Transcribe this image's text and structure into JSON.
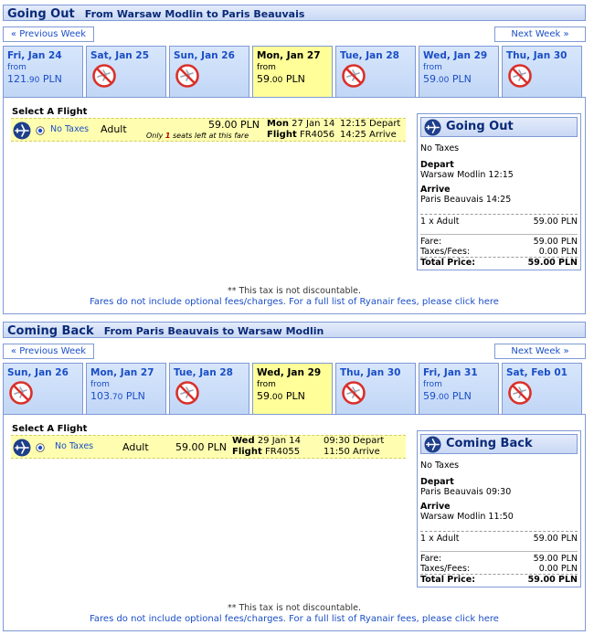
{
  "outbound": {
    "title": "Going Out",
    "route": "From Warsaw Modlin to Paris Beauvais",
    "prev_week": "« Previous Week",
    "next_week": "Next Week »",
    "days": [
      {
        "name": "Fri, Jan 24",
        "from": "from",
        "price_main": "121",
        "price_dec": ".90",
        "currency": "PLN",
        "available": true
      },
      {
        "name": "Sat, Jan 25",
        "available": false
      },
      {
        "name": "Sun, Jan 26",
        "available": false
      },
      {
        "name": "Mon, Jan 27",
        "from": "from",
        "price_main": "59",
        "price_dec": ".00",
        "currency": "PLN",
        "available": true,
        "selected": true
      },
      {
        "name": "Tue, Jan 28",
        "available": false
      },
      {
        "name": "Wed, Jan 29",
        "from": "from",
        "price_main": "59",
        "price_dec": ".00",
        "currency": "PLN",
        "available": true
      },
      {
        "name": "Thu, Jan 30",
        "available": false
      }
    ],
    "select_title": "Select A Flight",
    "flight": {
      "fare": "No Taxes",
      "passenger": "Adult",
      "price": "59.00 PLN",
      "seats_pre": "Only",
      "seats_num": "1",
      "seats_post": "seats left at this fare",
      "day_label": "Mon",
      "date": "27 Jan 14",
      "flight_label": "Flight",
      "flight_no": "FR4056",
      "depart": "12:15 Depart",
      "arrive": "14:25 Arrive"
    },
    "summary": {
      "title": "Going Out",
      "fare": "No Taxes",
      "depart_label": "Depart",
      "depart": "Warsaw Modlin 12:15",
      "arrive_label": "Arrive",
      "arrive": "Paris Beauvais 14:25",
      "pax": "1 x Adult",
      "pax_price": "59.00 PLN",
      "fare_label": "Fare:",
      "fare_price": "59.00 PLN",
      "taxes_label": "Taxes/Fees:",
      "taxes_price": "0.00 PLN",
      "total_label": "Total Price:",
      "total_price": "59.00 PLN"
    },
    "note": "** This tax is not discountable.",
    "fees_link": "Fares do not include optional fees/charges. For a full list of Ryanair fees, please click here"
  },
  "return": {
    "title": "Coming Back",
    "route": "From Paris Beauvais to Warsaw Modlin",
    "prev_week": "« Previous Week",
    "next_week": "Next Week »",
    "days": [
      {
        "name": "Sun, Jan 26",
        "available": false
      },
      {
        "name": "Mon, Jan 27",
        "from": "from",
        "price_main": "103",
        "price_dec": ".70",
        "currency": "PLN",
        "available": true
      },
      {
        "name": "Tue, Jan 28",
        "available": false
      },
      {
        "name": "Wed, Jan 29",
        "from": "from",
        "price_main": "59",
        "price_dec": ".00",
        "currency": "PLN",
        "available": true,
        "selected": true
      },
      {
        "name": "Thu, Jan 30",
        "available": false
      },
      {
        "name": "Fri, Jan 31",
        "from": "from",
        "price_main": "59",
        "price_dec": ".00",
        "currency": "PLN",
        "available": true
      },
      {
        "name": "Sat, Feb 01",
        "available": false
      }
    ],
    "select_title": "Select A Flight",
    "flight": {
      "fare": "No Taxes",
      "passenger": "Adult",
      "price": "59.00 PLN",
      "day_label": "Wed",
      "date": "29 Jan 14",
      "flight_label": "Flight",
      "flight_no": "FR4055",
      "depart": "09:30 Depart",
      "arrive": "11:50 Arrive"
    },
    "summary": {
      "title": "Coming Back",
      "fare": "No Taxes",
      "depart_label": "Depart",
      "depart": "Paris Beauvais 09:30",
      "arrive_label": "Arrive",
      "arrive": "Warsaw Modlin 11:50",
      "pax": "1 x Adult",
      "pax_price": "59.00 PLN",
      "fare_label": "Fare:",
      "fare_price": "59.00 PLN",
      "taxes_label": "Taxes/Fees:",
      "taxes_price": "0.00 PLN",
      "total_label": "Total Price:",
      "total_price": "59.00 PLN"
    },
    "note": "** This tax is not discountable.",
    "fees_link": "Fares do not include optional fees/charges. For a full list of Ryanair fees, please click here"
  },
  "icons": {
    "plane": "plane-icon",
    "no_flight": "no-flight-icon",
    "radio": "radio-selected-icon"
  },
  "colors": {
    "link_blue": "#1a4ec6",
    "header_navy": "#0a2a78",
    "border_blue": "#7f9ad6",
    "selected_yellow": "#fffe98",
    "no_flight_red": "#d9302a"
  }
}
